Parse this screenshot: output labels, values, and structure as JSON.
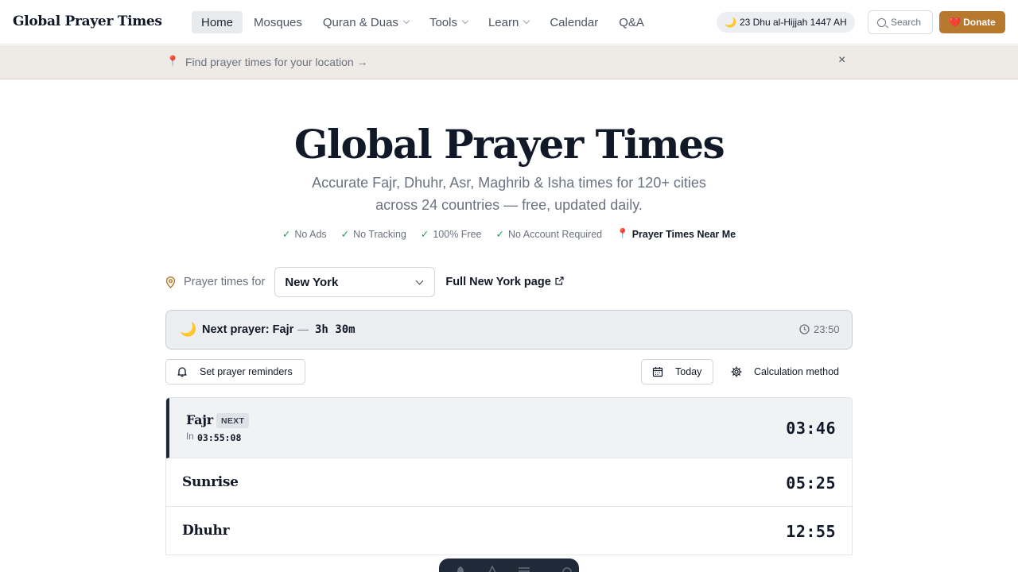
{
  "header": {
    "logo": "Global Prayer Times",
    "nav": [
      {
        "label": "Home",
        "active": true,
        "dropdown": false
      },
      {
        "label": "Mosques",
        "active": false,
        "dropdown": false
      },
      {
        "label": "Quran & Duas",
        "active": false,
        "dropdown": true
      },
      {
        "label": "Tools",
        "active": false,
        "dropdown": true
      },
      {
        "label": "Learn",
        "active": false,
        "dropdown": true
      },
      {
        "label": "Calendar",
        "active": false,
        "dropdown": false
      },
      {
        "label": "Q&A",
        "active": false,
        "dropdown": false
      }
    ],
    "hijri_date": "23 Dhu al-Hijjah 1447 AH",
    "search_label": "Search",
    "donate_label": "Donate"
  },
  "banner": {
    "text": "Find prayer times for your location →",
    "close": "×"
  },
  "hero": {
    "title": "Global Prayer Times",
    "subtitle_line1": "Accurate Fajr, Dhuhr, Asr, Maghrib & Isha times for 120+ cities",
    "subtitle_line2": "across 24 countries — free, updated daily.",
    "features": [
      "No Ads",
      "No Tracking",
      "100% Free",
      "No Account Required"
    ],
    "near_me": "Prayer Times Near Me"
  },
  "city_picker": {
    "label": "Prayer times for",
    "selected": "New York",
    "full_page_link": "Full New York page"
  },
  "next_prayer": {
    "label": "Next prayer: Fajr",
    "dash": "—",
    "countdown": "3h 30m",
    "current_time": "23:50"
  },
  "actions": {
    "reminders": "Set prayer reminders",
    "today": "Today",
    "calculation": "Calculation method"
  },
  "prayers": [
    {
      "name": "Fajr",
      "time": "03:46",
      "next": true,
      "badge": "NEXT",
      "in_label": "In",
      "in_countdown": "03:55:08"
    },
    {
      "name": "Sunrise",
      "time": "05:25",
      "next": false
    },
    {
      "name": "Dhuhr",
      "time": "12:55",
      "next": false
    }
  ],
  "colors": {
    "accent": "#b7792d",
    "text_dark": "#111827",
    "muted": "#6b7280",
    "success": "#16a34a",
    "dock": "#1f2937"
  }
}
